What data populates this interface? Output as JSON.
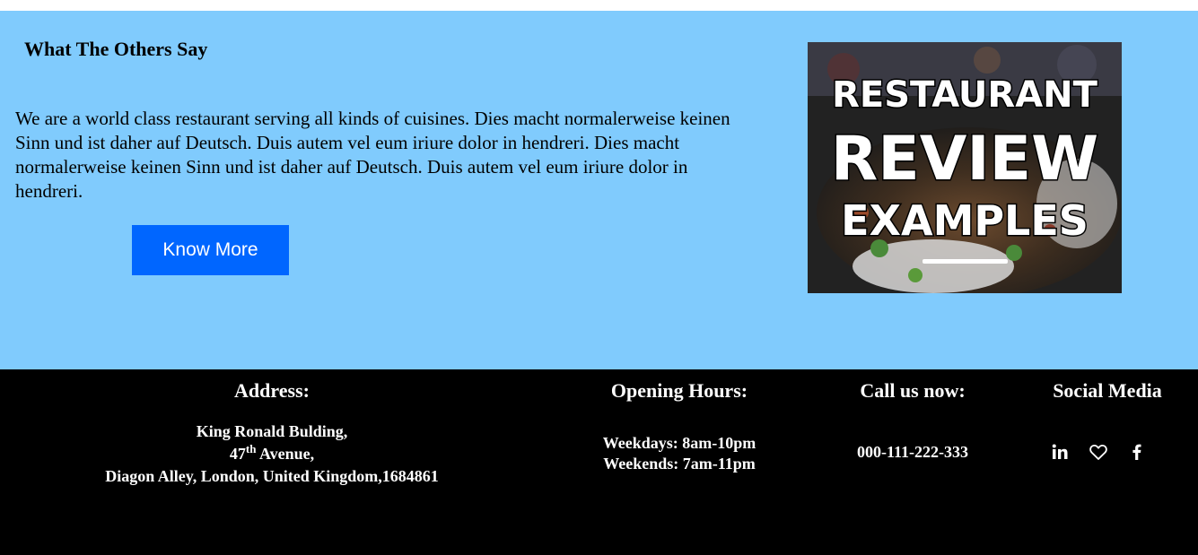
{
  "section": {
    "heading": "What The Others Say",
    "paragraph": "We are a world class restaurant serving all kinds of cuisines. Dies macht normalerweise keinen Sinn und ist daher auf Deutsch. Duis autem vel eum iriure dolor in hendreri. Dies macht normalerweise keinen Sinn und ist daher auf Deutsch. Duis autem vel eum iriure dolor in hendreri.",
    "button_label": "Know More",
    "image": {
      "line1": "RESTAURANT",
      "line2": "REVIEW",
      "line3": "EXAMPLES"
    }
  },
  "footer": {
    "address": {
      "title": "Address:",
      "line1": "King Ronald Bulding,",
      "line2_num": "47",
      "line2_sup": "th",
      "line2_rest": " Avenue,",
      "line3": "Diagon Alley, London, United Kingdom,1684861"
    },
    "hours": {
      "title": "Opening Hours:",
      "weekdays": "Weekdays: 8am-10pm",
      "weekends": "Weekends: 7am-11pm"
    },
    "call": {
      "title": "Call us now:",
      "phone": "000-111-222-333"
    },
    "social": {
      "title": "Social Media",
      "icons": [
        "linkedin-icon",
        "heart-icon",
        "facebook-icon"
      ]
    }
  },
  "colors": {
    "section_bg": "#80cbfd",
    "button_bg": "#0066ff",
    "footer_bg": "#000000"
  }
}
